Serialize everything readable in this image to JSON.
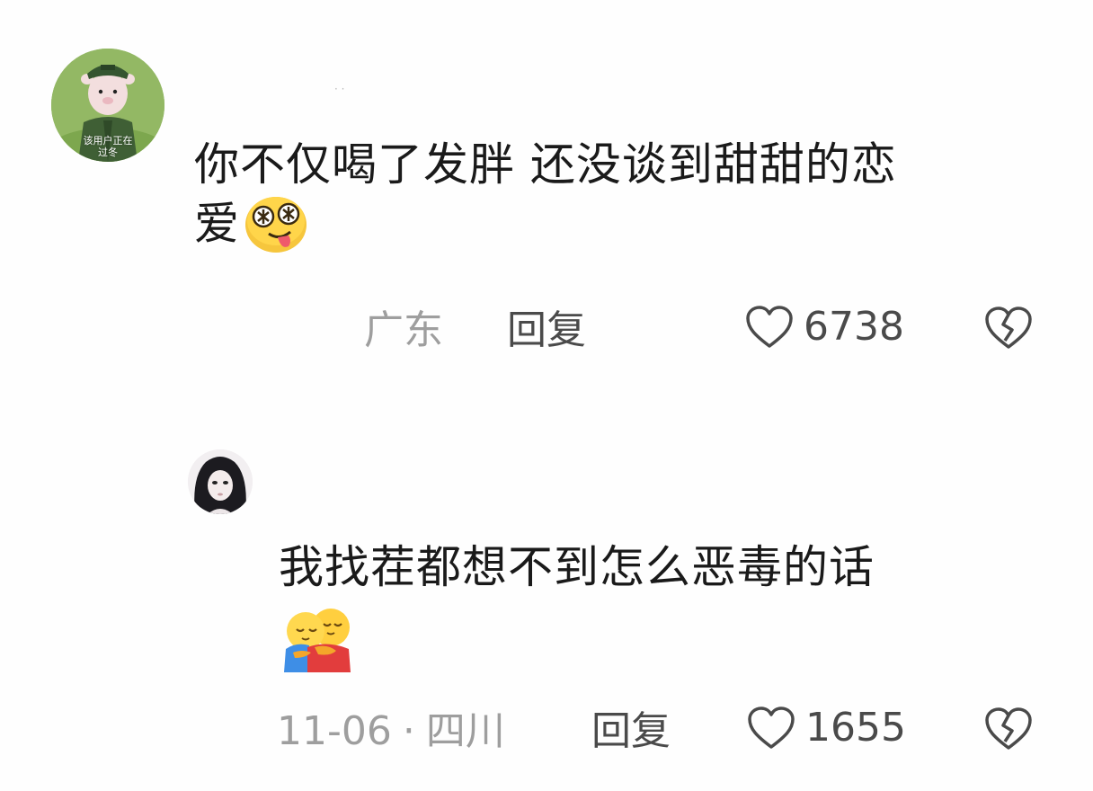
{
  "comments": [
    {
      "avatar_caption": "该用户正在\n过冬",
      "text_line1": "你不仅喝了发胖 还没谈到甜甜的恋",
      "text_line2": "爱",
      "emoji": "drooling-face-emoji",
      "location": "广东",
      "reply_label": "回复",
      "like_count": "6738",
      "icons": {
        "like": "heart-outline-icon",
        "dislike": "broken-heart-icon"
      }
    },
    {
      "text_line1": "我找茬都想不到怎么恶毒的话",
      "emoji": "hug-emoji",
      "date": "11-06",
      "separator": "·",
      "location": "四川",
      "reply_label": "回复",
      "like_count": "1655",
      "icons": {
        "like": "heart-outline-icon",
        "dislike": "broken-heart-icon"
      }
    }
  ],
  "colors": {
    "text": "#1a1a1a",
    "meta_gray": "#9e9e9e",
    "reply_dark": "#4a4a4a",
    "background": "#fefefe"
  }
}
